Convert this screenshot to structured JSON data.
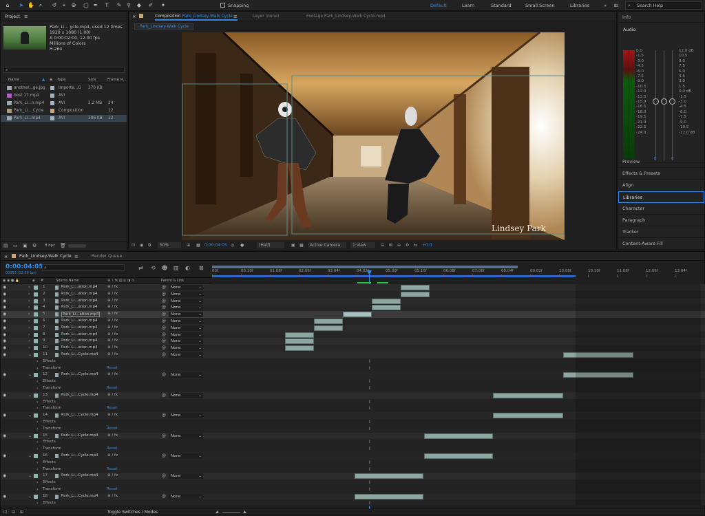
{
  "toolbar": {
    "snapping_label": "Snapping",
    "workspaces": [
      "Default",
      "Learn",
      "Standard",
      "Small Screen",
      "Libraries"
    ],
    "active_workspace": "Default",
    "search_placeholder": "Search Help"
  },
  "project": {
    "title": "Project",
    "file_name": "Park_Li... ycle.mp4",
    "used": ", used 12 times",
    "resolution": "1920 x 1080 (1.00)",
    "duration": "Δ 0:00:02:00, 12.00 fps",
    "colors": "Millions of Colors",
    "codec": "H.264",
    "columns": [
      "Name",
      "Type",
      "Size",
      "Frame R..."
    ],
    "items": [
      {
        "name": "another...ge.jpg",
        "type": "Importe...G",
        "size": "370 KB",
        "fr": ""
      },
      {
        "name": "best 17.mp4",
        "type": "AVI",
        "size": "",
        "fr": ""
      },
      {
        "name": "Park_Li...n.mp4",
        "type": "AVI",
        "size": "2.2 MB",
        "fr": "24"
      },
      {
        "name": "Park_Li... Cycle",
        "type": "Composition",
        "size": "",
        "fr": "12"
      },
      {
        "name": "Park_Li...mp4",
        "type": "AVI",
        "size": "386 KB",
        "fr": "12"
      }
    ],
    "bpc": "8 bpc"
  },
  "viewer": {
    "comp_tab_prefix": "Composition",
    "comp_tab_name": "Park_Lindsey-Walk Cycle",
    "layer_tab": "Layer (none)",
    "footage_tab": "Footage Park_Lindsey-Walk Cycle.mp4",
    "sub_tab": "Park_Lindsey-Walk Cycle",
    "watermark": "Lindsey Park",
    "zoom": "50%",
    "timecode": "0:00:04:05",
    "resolution": "(Half)",
    "camera": "Active Camera",
    "views": "1 View",
    "exposure": "+0.0"
  },
  "right_panel": {
    "info": "Info",
    "audio": "Audio",
    "left_scale": [
      "0.0",
      "-1.5",
      "-3.0",
      "-4.5",
      "-6.0",
      "-7.5",
      "-9.0",
      "-10.5",
      "-12.0",
      "-13.5",
      "-15.0",
      "-16.5",
      "-18.0",
      "-19.5",
      "-21.0",
      "-22.5",
      "-24.0"
    ],
    "right_scale": [
      "12.0 dB",
      "10.5",
      "9.0",
      "7.5",
      "6.0",
      "4.5",
      "3.0",
      "1.5",
      "0.0 dB",
      "-1.5",
      "-3.0",
      "-4.5",
      "-6.0",
      "-7.5",
      "-9.0",
      "-10.5",
      "-12.0 dB"
    ],
    "meter_values": [
      "0",
      "0"
    ],
    "items": [
      "Preview",
      "Effects & Presets",
      "Align",
      "Libraries",
      "Character",
      "Paragraph",
      "Tracker",
      "Content-Aware Fill"
    ],
    "active_item": "Libraries"
  },
  "timeline": {
    "tab_name": "Park_Lindsey-Walk Cycle",
    "render_queue": "Render Queue",
    "timecode": "0:00:04:05",
    "frame_info": "00053 (12.00 fps)",
    "search_placeholder": "",
    "columns": {
      "source": "Source Name",
      "parent": "Parent & Link"
    },
    "ruler": [
      "00f",
      "00:10f",
      "01:08f",
      "02:06f",
      "03:04f",
      "04:02f",
      "05:00f",
      "05:10f",
      "06:08f",
      "07:06f",
      "08:04f",
      "09:02f",
      "10:00f",
      "10:10f",
      "11:08f",
      "12:06f",
      "13:04f"
    ],
    "reset_label": "Reset",
    "effects_label": "Effects",
    "transform_label": "Transform",
    "parent_value": "None",
    "toggle_label": "Toggle Switches / Modes",
    "layers": [
      {
        "num": "1",
        "name": "Park_Li...ation.mp4",
        "expanded": false
      },
      {
        "num": "2",
        "name": "Park_Li...ation.mp4",
        "expanded": false
      },
      {
        "num": "3",
        "name": "Park_Li...ation.mp4",
        "expanded": false
      },
      {
        "num": "4",
        "name": "Park_Li...ation.mp4",
        "expanded": false
      },
      {
        "num": "5",
        "name": "Park_Li...ation.mp4",
        "expanded": false,
        "selected": true
      },
      {
        "num": "6",
        "name": "Park_Li...ation.mp4",
        "expanded": false
      },
      {
        "num": "7",
        "name": "Park_Li...ation.mp4",
        "expanded": false
      },
      {
        "num": "8",
        "name": "Park_Li...ation.mp4",
        "expanded": false
      },
      {
        "num": "9",
        "name": "Park_Li...ation.mp4",
        "expanded": false
      },
      {
        "num": "10",
        "name": "Park_Li...ation.mp4",
        "expanded": false
      },
      {
        "num": "11",
        "name": "Park_Li...Cycle.mp4",
        "expanded": true
      },
      {
        "num": "12",
        "name": "Park_Li...Cycle.mp4",
        "expanded": true
      },
      {
        "num": "13",
        "name": "Park_Li...Cycle.mp4",
        "expanded": true
      },
      {
        "num": "14",
        "name": "Park_Li...Cycle.mp4",
        "expanded": true
      },
      {
        "num": "15",
        "name": "Park_Li...Cycle.mp4",
        "expanded": true
      },
      {
        "num": "16",
        "name": "Park_Li...Cycle.mp4",
        "expanded": true
      },
      {
        "num": "17",
        "name": "Park_Li...Cycle.mp4",
        "expanded": true
      },
      {
        "num": "18",
        "name": "Park_Li...Cycle.mp4",
        "expanded": true
      }
    ]
  }
}
